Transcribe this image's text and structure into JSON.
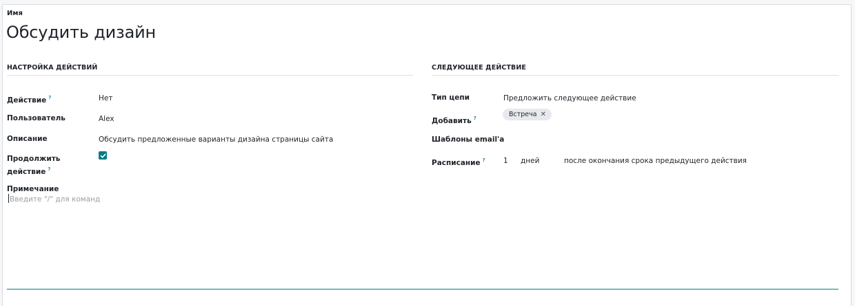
{
  "form": {
    "name_label": "Имя",
    "title": "Обсудить дизайн"
  },
  "left_group": {
    "heading": "НАСТРОЙКА ДЕЙСТВИЙ",
    "action_label": "Действие",
    "action_value": "Нет",
    "user_label": "Пользователь",
    "user_value": "Alex",
    "description_label": "Описание",
    "description_value": "Обсудить предложенные варианты дизайна страницы сайта",
    "continue_label_1": "Продолжить",
    "continue_label_2": "действие",
    "continue_checked": true,
    "note_label": "Примечание",
    "note_placeholder": "Введите \"/\" для команд"
  },
  "right_group": {
    "heading": "СЛЕДУЮЩЕЕ ДЕЙСТВИЕ",
    "chain_label": "Тип цепи",
    "chain_value": "Предложить следующее действие",
    "add_label": "Добавить",
    "add_tag": "Встреча",
    "templates_label": "Шаблоны email'а",
    "schedule_label": "Расписание",
    "schedule_number": "1",
    "schedule_unit": "дней",
    "schedule_relation": "после окончания срока предыдущего действия"
  },
  "help_mark": "?",
  "remove_glyph": "✕",
  "colors": {
    "accent": "#017e84",
    "help": "#2d7f9b",
    "tag_bg": "#e7e9ed"
  }
}
